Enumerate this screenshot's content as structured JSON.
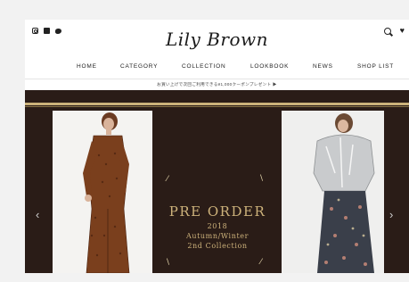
{
  "header": {
    "logo_text": "Lily Brown",
    "social_icons": [
      "instagram-icon",
      "facebook-icon",
      "twitter-icon"
    ],
    "right_icons": [
      "search-icon",
      "heart-icon"
    ]
  },
  "nav": {
    "items": [
      "HOME",
      "CATEGORY",
      "COLLECTION",
      "LOOKBOOK",
      "NEWS",
      "SHOP LIST"
    ]
  },
  "notice": {
    "text": "お買い上げで次回ご利用できる¥1,000クーポンプレゼント ▶"
  },
  "hero": {
    "title": "PRE ORDER",
    "year": "2018",
    "season": "Autumn/Winter",
    "collection": "2nd Collection",
    "colors": {
      "background": "#2a1c17",
      "accent": "#cbb27a"
    }
  }
}
